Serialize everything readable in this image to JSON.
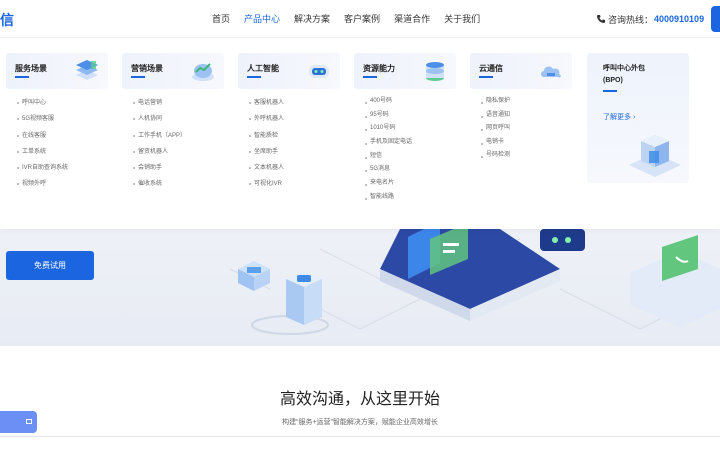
{
  "header": {
    "logo": "信",
    "nav": [
      "首页",
      "产品中心",
      "解决方案",
      "客户案例",
      "渠道合作",
      "关于我们"
    ],
    "active_nav": "产品中心",
    "hotline_label": "咨询热线：",
    "hotline_number": "4000910109"
  },
  "menu": {
    "columns": [
      {
        "title": "服务场景",
        "items": [
          "呼叫中心",
          "5G视频客服",
          "在线客服",
          "工单系统",
          "IVR自助查询系统",
          "视频外呼"
        ]
      },
      {
        "title": "营销场景",
        "items": [
          "电话营销",
          "人机协同",
          "工作手机（APP）",
          "留资机器人",
          "会销助手",
          "催收系统"
        ]
      },
      {
        "title": "人工智能",
        "items": [
          "客服机器人",
          "外呼机器人",
          "智能质检",
          "坐席助手",
          "文本机器人",
          "可视化IVR"
        ]
      },
      {
        "title": "资源能力",
        "items": [
          "400号码",
          "95号码",
          "1010号码",
          "手机及固定电话",
          "短信",
          "5G消息",
          "来电名片",
          "智能线路"
        ]
      },
      {
        "title": "云通信",
        "items": [
          "隐私保护",
          "语音通知",
          "网页呼叫",
          "电销卡",
          "号码检测"
        ]
      }
    ],
    "bpo": {
      "title_line1": "呼叫中心外包",
      "title_line2": "(BPO)",
      "more": "了解更多"
    }
  },
  "hero": {
    "cta": "免费试用"
  },
  "section": {
    "slogan": "高效沟通，从这里开始",
    "subtitle": "构建“服务+运营”智能解决方案，赋能企业高效增长"
  },
  "colors": {
    "accent": "#1b66e0",
    "hero_bg": "#eef1f7"
  }
}
